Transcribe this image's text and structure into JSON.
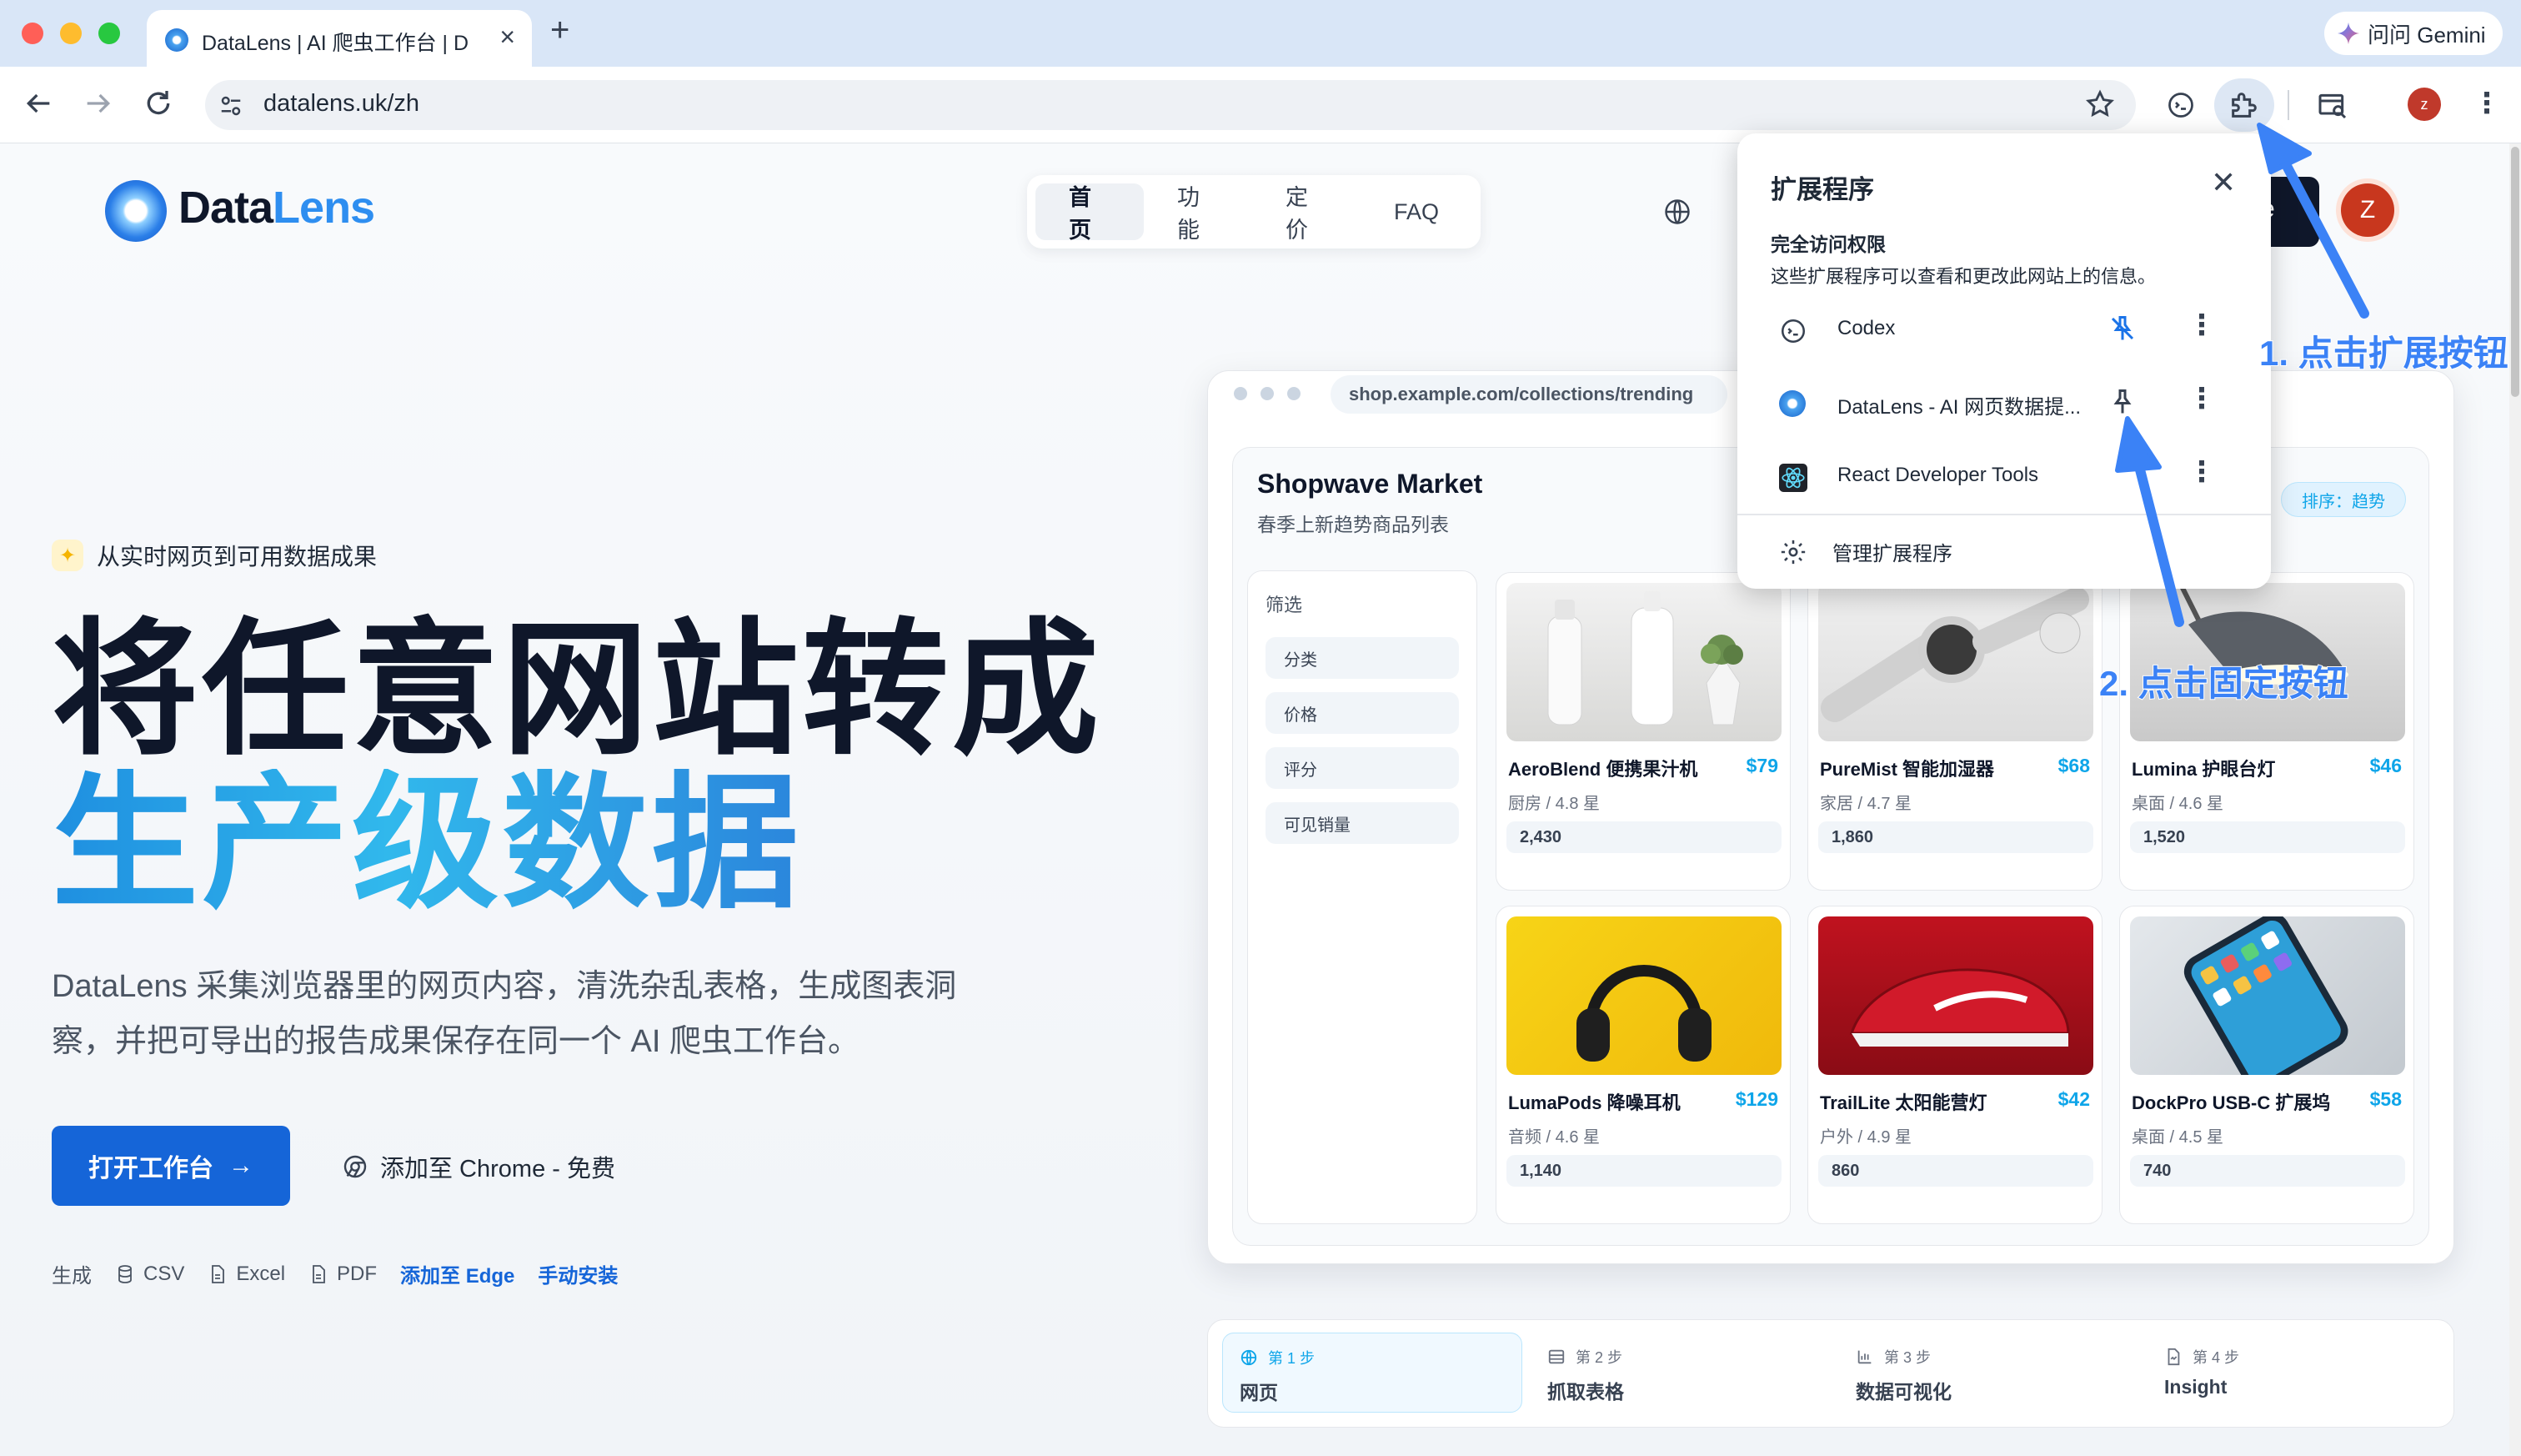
{
  "browser": {
    "tab_title": "DataLens | AI 爬虫工作台 | DataLens",
    "new_tab": "+",
    "gemini_label": "问问 Gemini",
    "url": "datalens.uk/zh",
    "profile_initial": "z"
  },
  "site": {
    "logo_a": "Data",
    "logo_b": "Lens",
    "nav": [
      {
        "label": "首页"
      },
      {
        "label": "功能"
      },
      {
        "label": "定价"
      },
      {
        "label": "FAQ"
      }
    ],
    "nav_avatar": "Z",
    "nav_btn_partial": "e"
  },
  "hero": {
    "badge": "从实时网页到可用数据成果",
    "title_line1": "将任意网站转成",
    "title_line2": "生产级数据",
    "description": "DataLens 采集浏览器里的网页内容，清洗杂乱表格，生成图表洞察，并把可导出的报告成果保存在同一个 AI 爬虫工作台。",
    "cta_label": "打开工作台",
    "chrome_label": "添加至 Chrome - 免费",
    "formats_prefix": "生成",
    "formats": [
      "CSV",
      "Excel",
      "PDF"
    ],
    "edge_link": "添加至 Edge",
    "manual_link": "手动安装"
  },
  "mock": {
    "url": "shop.example.com/collections/trending",
    "shop_title": "Shopwave Market",
    "shop_subtitle": "春季上新趋势商品列表",
    "sort_badge": "排序：趋势",
    "filter_title": "筛选",
    "filters": [
      "分类",
      "价格",
      "评分",
      "可见销量"
    ],
    "products": [
      {
        "name": "AeroBlend 便携果汁机",
        "price": "$79",
        "meta": "厨房 / 4.8 星",
        "sales": "2,430"
      },
      {
        "name": "PureMist 智能加湿器",
        "price": "$68",
        "meta": "家居 / 4.7 星",
        "sales": "1,860"
      },
      {
        "name": "Lumina 护眼台灯",
        "price": "$46",
        "meta": "桌面 / 4.6 星",
        "sales": "1,520"
      },
      {
        "name": "LumaPods 降噪耳机",
        "price": "$129",
        "meta": "音频 / 4.6 星",
        "sales": "1,140"
      },
      {
        "name": "TrailLite 太阳能营灯",
        "price": "$42",
        "meta": "户外 / 4.9 星",
        "sales": "860"
      },
      {
        "name": "DockPro USB-C 扩展坞",
        "price": "$58",
        "meta": "桌面 / 4.5 星",
        "sales": "740"
      }
    ],
    "steps": [
      {
        "num": "第 1 步",
        "label": "网页"
      },
      {
        "num": "第 2 步",
        "label": "抓取表格"
      },
      {
        "num": "第 3 步",
        "label": "数据可视化"
      },
      {
        "num": "第 4 步",
        "label": "Insight"
      }
    ]
  },
  "extensions": {
    "title": "扩展程序",
    "perm_title": "完全访问权限",
    "perm_desc": "这些扩展程序可以查看和更改此网站上的信息。",
    "items": [
      {
        "name": "Codex"
      },
      {
        "name": "DataLens - AI 网页数据提..."
      },
      {
        "name": "React Developer Tools"
      }
    ],
    "manage": "管理扩展程序"
  },
  "annotations": {
    "step1": "1. 点击扩展按钮",
    "step2": "2. 点击固定按钮"
  },
  "colors": {
    "accent": "#1565d8",
    "annotation": "#3b82f6",
    "price": "#0ea5e9"
  }
}
